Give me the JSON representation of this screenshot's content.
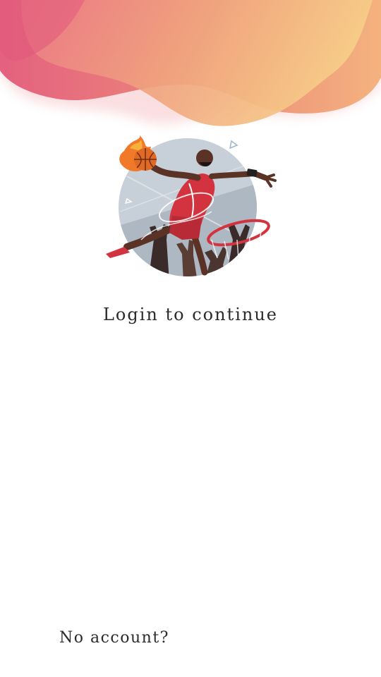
{
  "screen": {
    "title": "Login to continue",
    "footer_link": "No account?"
  },
  "icons": {
    "header": "wave-gradient-icon",
    "hero": "basketball-dunk-illustration-icon"
  },
  "colors": {
    "gradient_pink": "#e8608a",
    "gradient_peach": "#f0a878",
    "gradient_yellow": "#f6cc86",
    "accent_red": "#d3333f",
    "text": "#2b2b2b",
    "background": "#ffffff"
  }
}
